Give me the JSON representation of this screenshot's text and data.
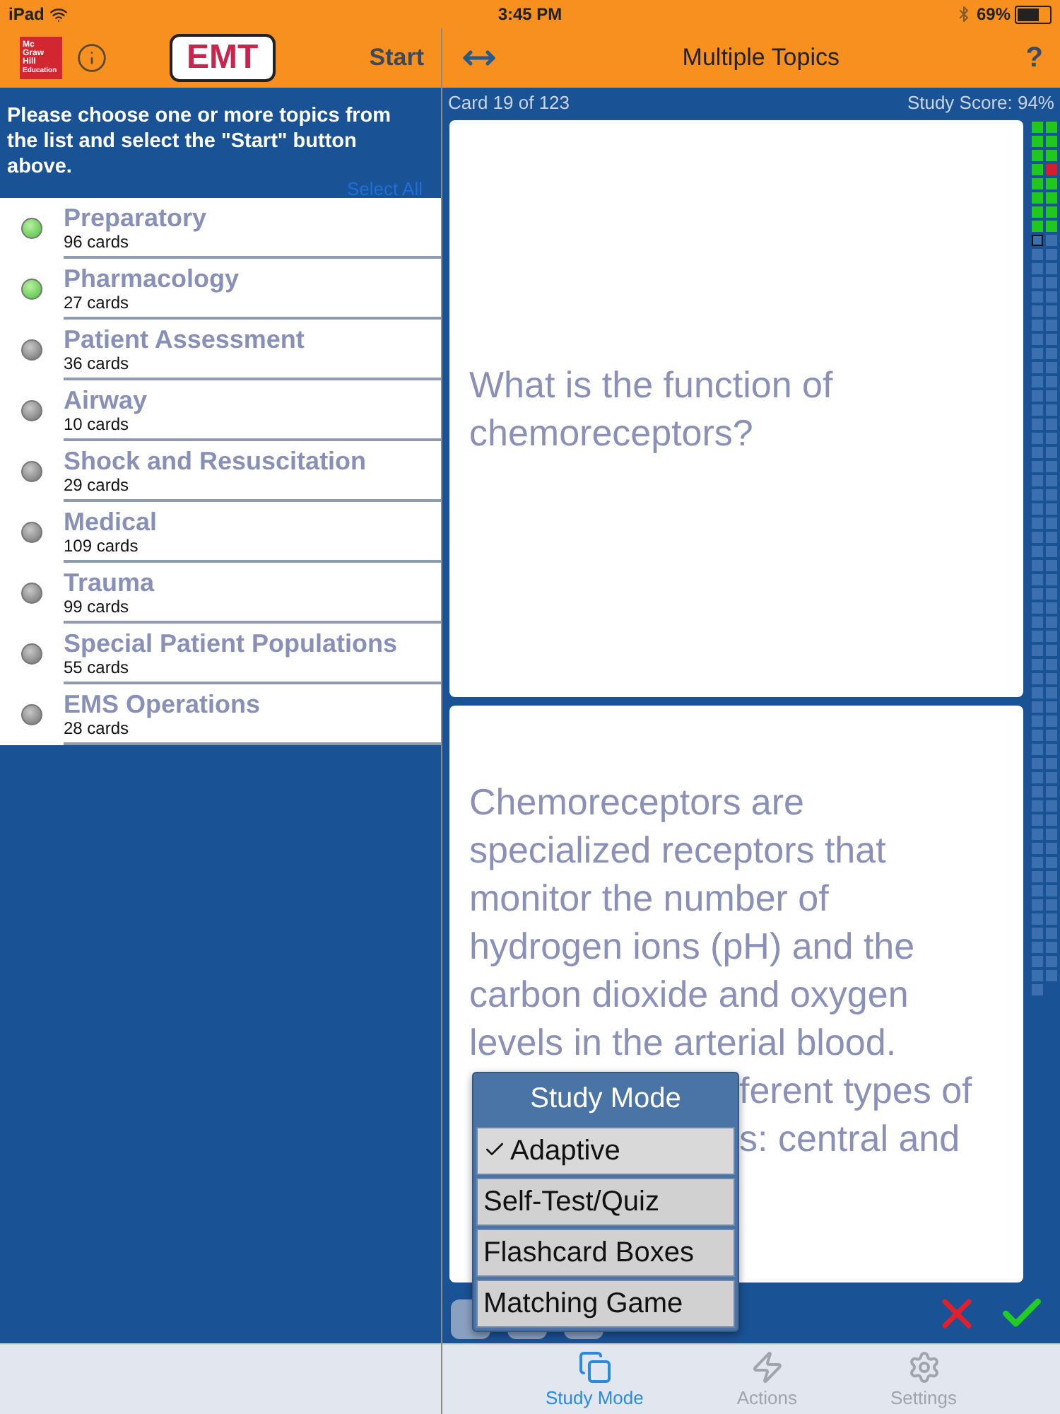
{
  "status_bar": {
    "device": "iPad",
    "time": "3:45 PM",
    "battery": "69%"
  },
  "left_header": {
    "logo_text": [
      "Mc",
      "Graw",
      "Hill",
      "Education"
    ],
    "title": "EMT",
    "start_button": "Start"
  },
  "instructions": "Please choose one or more topics from the list and select the \"Start\" button above.",
  "select_all": "Select All",
  "topics": [
    {
      "name": "Preparatory",
      "count": "96 cards",
      "selected": true
    },
    {
      "name": "Pharmacology",
      "count": "27 cards",
      "selected": true
    },
    {
      "name": "Patient Assessment",
      "count": "36 cards",
      "selected": false
    },
    {
      "name": "Airway",
      "count": "10 cards",
      "selected": false
    },
    {
      "name": "Shock and Resuscitation",
      "count": "29 cards",
      "selected": false
    },
    {
      "name": "Medical",
      "count": "109 cards",
      "selected": false
    },
    {
      "name": "Trauma",
      "count": "99 cards",
      "selected": false
    },
    {
      "name": "Special Patient Populations",
      "count": "55 cards",
      "selected": false
    },
    {
      "name": "EMS Operations",
      "count": "28 cards",
      "selected": false
    }
  ],
  "right_header": {
    "title": "Multiple Topics",
    "help": "?"
  },
  "card_info": {
    "position": "Card 19 of 123",
    "score": "Study Score: 94%"
  },
  "question": "What is the function of chemoreceptors?",
  "answer": {
    "text": "Chemoreceptors are specialized receptors that monitor the number of hydrogen ions (pH) and the carbon dioxide and oxygen levels in the arterial blood.",
    "fragments": [
      "ferent types of",
      "s: central and"
    ]
  },
  "score_cells": [
    {
      "kind": "correct"
    },
    {
      "kind": "correct"
    },
    {
      "kind": "correct"
    },
    {
      "kind": "correct"
    },
    {
      "kind": "correct"
    },
    {
      "kind": "correct"
    },
    {
      "kind": "correct"
    },
    {
      "kind": "wrong"
    },
    {
      "kind": "correct"
    },
    {
      "kind": "correct"
    },
    {
      "kind": "correct"
    },
    {
      "kind": "correct"
    },
    {
      "kind": "correct"
    },
    {
      "kind": "correct"
    },
    {
      "kind": "correct"
    },
    {
      "kind": "correct"
    },
    {
      "kind": "current"
    },
    {
      "kind": "unseen"
    },
    {
      "kind": "unseen"
    },
    {
      "kind": "unseen"
    },
    {
      "kind": "unseen"
    },
    {
      "kind": "unseen"
    },
    {
      "kind": "unseen"
    },
    {
      "kind": "unseen"
    },
    {
      "kind": "unseen"
    },
    {
      "kind": "unseen"
    },
    {
      "kind": "unseen"
    },
    {
      "kind": "unseen"
    },
    {
      "kind": "unseen"
    },
    {
      "kind": "unseen"
    },
    {
      "kind": "unseen"
    },
    {
      "kind": "unseen"
    },
    {
      "kind": "unseen"
    },
    {
      "kind": "unseen"
    },
    {
      "kind": "unseen"
    },
    {
      "kind": "unseen"
    },
    {
      "kind": "unseen"
    },
    {
      "kind": "unseen"
    },
    {
      "kind": "unseen"
    },
    {
      "kind": "unseen"
    },
    {
      "kind": "unseen"
    },
    {
      "kind": "unseen"
    },
    {
      "kind": "unseen"
    },
    {
      "kind": "unseen"
    },
    {
      "kind": "unseen"
    },
    {
      "kind": "unseen"
    },
    {
      "kind": "unseen"
    },
    {
      "kind": "unseen"
    },
    {
      "kind": "unseen"
    },
    {
      "kind": "unseen"
    },
    {
      "kind": "unseen"
    },
    {
      "kind": "unseen"
    },
    {
      "kind": "unseen"
    },
    {
      "kind": "unseen"
    },
    {
      "kind": "unseen"
    },
    {
      "kind": "unseen"
    },
    {
      "kind": "unseen"
    },
    {
      "kind": "unseen"
    },
    {
      "kind": "unseen"
    },
    {
      "kind": "unseen"
    },
    {
      "kind": "unseen"
    },
    {
      "kind": "unseen"
    },
    {
      "kind": "unseen"
    },
    {
      "kind": "unseen"
    },
    {
      "kind": "unseen"
    },
    {
      "kind": "unseen"
    },
    {
      "kind": "unseen"
    },
    {
      "kind": "unseen"
    },
    {
      "kind": "unseen"
    },
    {
      "kind": "unseen"
    },
    {
      "kind": "unseen"
    },
    {
      "kind": "unseen"
    },
    {
      "kind": "unseen"
    },
    {
      "kind": "unseen"
    },
    {
      "kind": "unseen"
    },
    {
      "kind": "unseen"
    },
    {
      "kind": "unseen"
    },
    {
      "kind": "unseen"
    },
    {
      "kind": "unseen"
    },
    {
      "kind": "unseen"
    },
    {
      "kind": "unseen"
    },
    {
      "kind": "unseen"
    },
    {
      "kind": "unseen"
    },
    {
      "kind": "unseen"
    },
    {
      "kind": "unseen"
    },
    {
      "kind": "unseen"
    },
    {
      "kind": "unseen"
    },
    {
      "kind": "unseen"
    },
    {
      "kind": "unseen"
    },
    {
      "kind": "unseen"
    },
    {
      "kind": "unseen"
    },
    {
      "kind": "unseen"
    },
    {
      "kind": "unseen"
    },
    {
      "kind": "unseen"
    },
    {
      "kind": "unseen"
    },
    {
      "kind": "unseen"
    },
    {
      "kind": "unseen"
    },
    {
      "kind": "unseen"
    },
    {
      "kind": "unseen"
    },
    {
      "kind": "unseen"
    },
    {
      "kind": "unseen"
    },
    {
      "kind": "unseen"
    },
    {
      "kind": "unseen"
    },
    {
      "kind": "unseen"
    },
    {
      "kind": "unseen"
    },
    {
      "kind": "unseen"
    },
    {
      "kind": "unseen"
    },
    {
      "kind": "unseen"
    },
    {
      "kind": "unseen"
    },
    {
      "kind": "unseen"
    },
    {
      "kind": "unseen"
    },
    {
      "kind": "unseen"
    },
    {
      "kind": "unseen"
    },
    {
      "kind": "unseen"
    },
    {
      "kind": "unseen"
    },
    {
      "kind": "unseen"
    },
    {
      "kind": "unseen"
    },
    {
      "kind": "unseen"
    },
    {
      "kind": "unseen"
    },
    {
      "kind": "unseen"
    },
    {
      "kind": "unseen"
    },
    {
      "kind": "unseen"
    },
    {
      "kind": "unseen"
    }
  ],
  "study_mode_menu": {
    "title": "Study Mode",
    "items": [
      {
        "label": "Adaptive",
        "selected": true
      },
      {
        "label": "Self-Test/Quiz",
        "selected": false
      },
      {
        "label": "Flashcard Boxes",
        "selected": false
      },
      {
        "label": "Matching Game",
        "selected": false
      }
    ]
  },
  "tabs": [
    {
      "label": "Study Mode",
      "kind": "study",
      "selected": true
    },
    {
      "label": "Actions",
      "kind": "actions",
      "selected": false
    },
    {
      "label": "Settings",
      "kind": "settings",
      "selected": false
    }
  ]
}
